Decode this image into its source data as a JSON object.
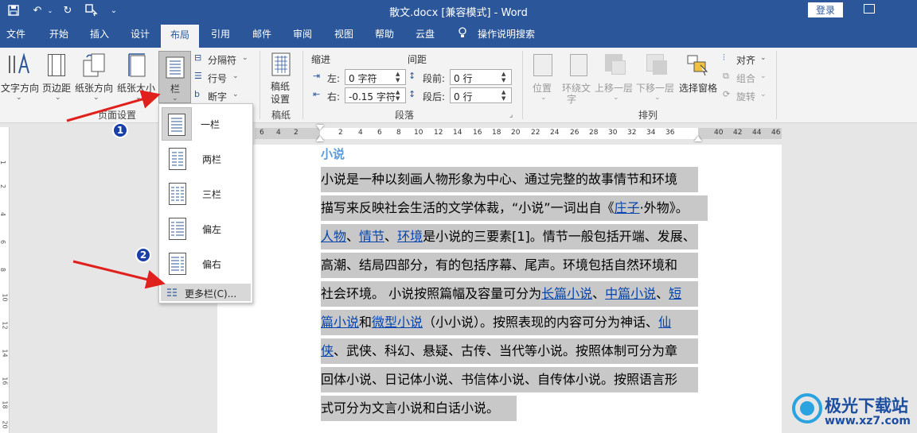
{
  "titlebar": {
    "doc_title": "散文.docx [兼容模式] - Word",
    "login": "登录"
  },
  "tabs": [
    "文件",
    "开始",
    "插入",
    "设计",
    "布局",
    "引用",
    "邮件",
    "审阅",
    "视图",
    "帮助",
    "云盘"
  ],
  "search_tab": "操作说明搜索",
  "ribbon": {
    "page_setup": {
      "text_direction": "文字方向",
      "margins": "页边距",
      "orientation": "纸张方向",
      "size": "纸张大小",
      "columns": "栏",
      "breaks": "分隔符",
      "line_numbers": "行号",
      "hyphenation": "断字",
      "group": "页面设置"
    },
    "draft": {
      "label1": "稿纸",
      "label2": "设置",
      "group": "稿纸"
    },
    "paragraph": {
      "indent_title": "缩进",
      "spacing_title": "间距",
      "left_label": "左:",
      "right_label": "右:",
      "before_label": "段前:",
      "after_label": "段后:",
      "indent_left": "0 字符",
      "indent_right": "-0.15 字符",
      "space_before": "0 行",
      "space_after": "0 行",
      "group": "段落"
    },
    "arrange": {
      "position": "位置",
      "wrap_text_1": "环绕文",
      "wrap_text_2": "字",
      "bring_forward": "上移一层",
      "send_backward": "下移一层",
      "selection_pane": "选择窗格",
      "align": "对齐",
      "group_btn": "组合",
      "rotate": "旋转",
      "group": "排列"
    }
  },
  "ruler": {
    "numbers": [
      "6",
      "4",
      "2",
      "2",
      "4",
      "6",
      "8",
      "10",
      "12",
      "14",
      "16",
      "18",
      "20",
      "22",
      "24",
      "26",
      "28",
      "30",
      "32",
      "34",
      "36",
      "40",
      "42",
      "44",
      "46"
    ],
    "vertical": [
      "1",
      "2",
      "4",
      "6",
      "8",
      "10",
      "12",
      "14",
      "16",
      "18",
      "20"
    ]
  },
  "columns_menu": {
    "items": [
      "一栏",
      "两栏",
      "三栏",
      "偏左",
      "偏右"
    ],
    "more": "更多栏(C)..."
  },
  "annotations": {
    "badge1": "1",
    "badge2": "2"
  },
  "document": {
    "heading": "小说",
    "lines": [
      [
        {
          "t": "小说是一种以刻画人物形象为中心、通过完整的故事情节和环境"
        }
      ],
      [
        {
          "t": "描写来反映社会生活的文学体裁，“小说”一词出自《"
        },
        {
          "t": "庄子",
          "link": true
        },
        {
          "t": "·外物》。"
        }
      ],
      [
        {
          "t": "人物",
          "link": true
        },
        {
          "t": "、"
        },
        {
          "t": "情节",
          "link": true
        },
        {
          "t": "、"
        },
        {
          "t": "环境",
          "link": true
        },
        {
          "t": "是小说的三要素[1]。情节一般包括开端、发展、"
        }
      ],
      [
        {
          "t": "高潮、结局四部分，有的包括序幕、尾声。环境包括自然环境和"
        }
      ],
      [
        {
          "t": "社会环境。 小说按照篇幅及容量可分为"
        },
        {
          "t": "长篇小说",
          "link": true
        },
        {
          "t": "、"
        },
        {
          "t": "中篇小说",
          "link": true
        },
        {
          "t": "、"
        },
        {
          "t": "短",
          "link": true
        }
      ],
      [
        {
          "t": "篇小说",
          "link": true
        },
        {
          "t": "和"
        },
        {
          "t": "微型小说",
          "link": true
        },
        {
          "t": "（小小说）。按照表现的内容可分为神话、"
        },
        {
          "t": "仙",
          "link": true
        }
      ],
      [
        {
          "t": "侠",
          "link": true
        },
        {
          "t": "、武侠、科幻、悬疑、古传、当代等小说。按照体制可分为章"
        }
      ],
      [
        {
          "t": "回体小说、日记体小说、书信体小说、自传体小说。按照语言形"
        }
      ],
      [
        {
          "t": "式可分为文言小说和白话小说。"
        }
      ]
    ]
  },
  "watermark": {
    "name": "极光下载站",
    "url": "www.xz7.com"
  },
  "colors": {
    "accent": "#2b579a",
    "selection": "#c8c8c8",
    "link": "#0645ad",
    "annotation_arrow": "#e0201c",
    "badge": "#1a3fa8"
  }
}
